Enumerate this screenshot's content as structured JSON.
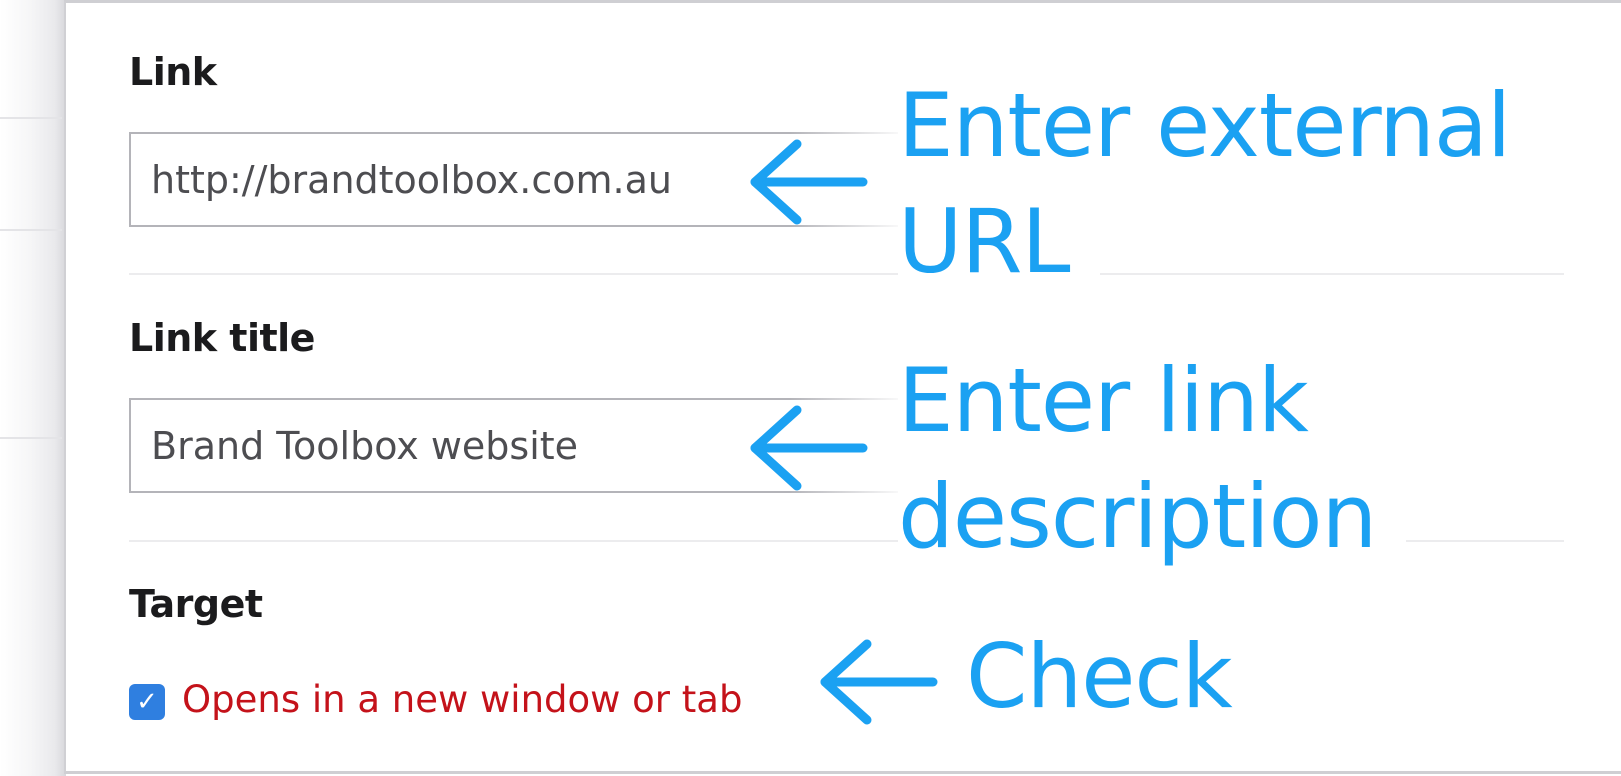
{
  "form": {
    "link": {
      "label": "Link",
      "value": "http://brandtoolbox.com.au"
    },
    "link_title": {
      "label": "Link title",
      "value": "Brand Toolbox website"
    },
    "target": {
      "label": "Target",
      "checkbox_checked": true,
      "checkbox_label": "Opens in a new window or tab"
    }
  },
  "annotations": {
    "url_line1": "Enter external",
    "url_line2": "URL",
    "desc_line1": "Enter link",
    "desc_line2": "description",
    "check": "Check",
    "arrow_color": "#1ba1f2"
  },
  "colors": {
    "checkbox_fill": "#2f7fe0",
    "checkbox_label": "#c4121a",
    "label_text": "#1b1b1d"
  },
  "icons": {
    "checkbox": "checkmark-icon",
    "annotation_arrow": "arrow-left-icon"
  }
}
